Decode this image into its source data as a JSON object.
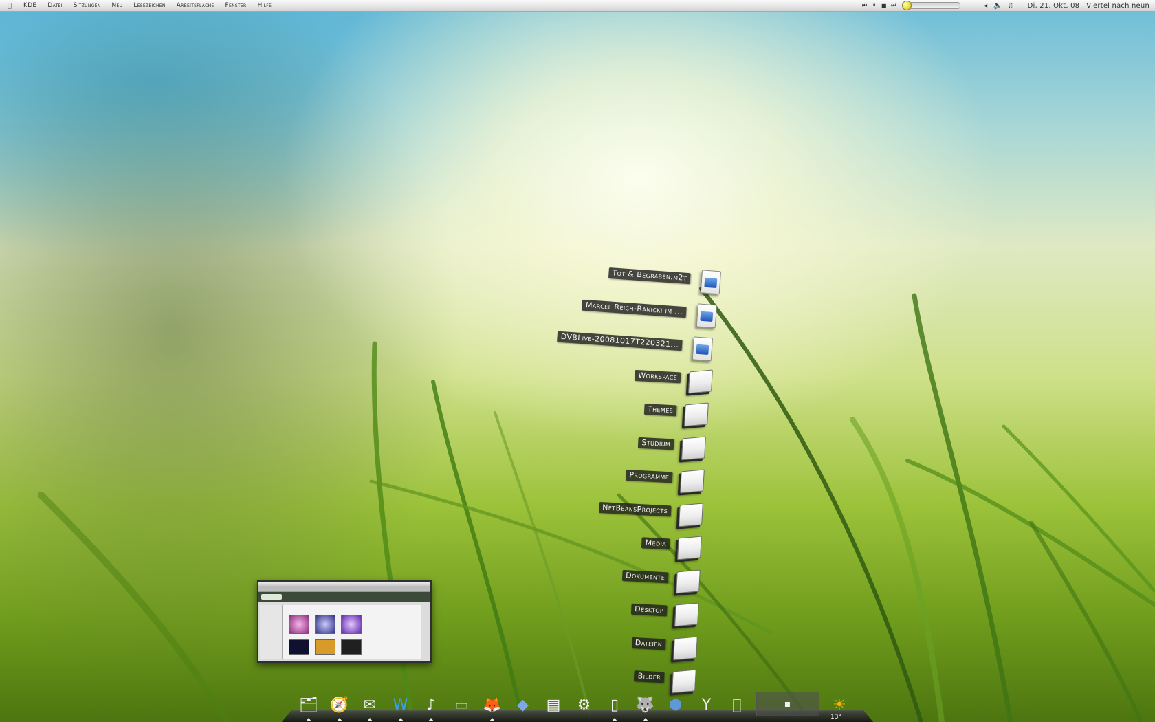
{
  "menubar": {
    "items": [
      "KDE",
      "Datei",
      "Sitzungen",
      "Neu",
      "Lesezeichen",
      "Arbeitsfläche",
      "Fenster",
      "Hilfe"
    ],
    "media_controls": [
      "previous-icon",
      "pause-icon",
      "stop-icon",
      "next-icon"
    ],
    "volume_level": 0.05,
    "clock_date": "Di, 21. Okt. 08",
    "clock_time": "Viertel nach neun"
  },
  "desktop_items": [
    {
      "label": "Tot & Begraben.m2t",
      "icon": "video-file-icon"
    },
    {
      "label": "Marcel Reich-Ranicki im ...",
      "icon": "video-file-icon"
    },
    {
      "label": "DVBLive-20081017T220321...",
      "icon": "video-file-icon"
    },
    {
      "label": "Workspace",
      "icon": "folder-icon"
    },
    {
      "label": "Themes",
      "icon": "folder-icon"
    },
    {
      "label": "Studium",
      "icon": "folder-icon"
    },
    {
      "label": "Programme",
      "icon": "folder-icon"
    },
    {
      "label": "NetBeansProjects",
      "icon": "folder-icon"
    },
    {
      "label": "Media",
      "icon": "folder-icon"
    },
    {
      "label": "Dokumente",
      "icon": "folder-icon"
    },
    {
      "label": "Desktop",
      "icon": "folder-icon"
    },
    {
      "label": "Dateien",
      "icon": "folder-icon"
    },
    {
      "label": "Bilder",
      "icon": "folder-icon"
    }
  ],
  "dock": {
    "weather_temp": "13°",
    "icons": [
      "finder-icon",
      "safari-icon",
      "mail-icon",
      "word-icon",
      "itunes-icon",
      "drive-icon",
      "gimp-icon",
      "box-icon",
      "preview-icon",
      "settings-icon",
      "document-icon",
      "wolf-icon",
      "package-icon",
      "antenna-icon",
      "apple-icon",
      "window-preview-icon",
      "weather-icon"
    ]
  }
}
